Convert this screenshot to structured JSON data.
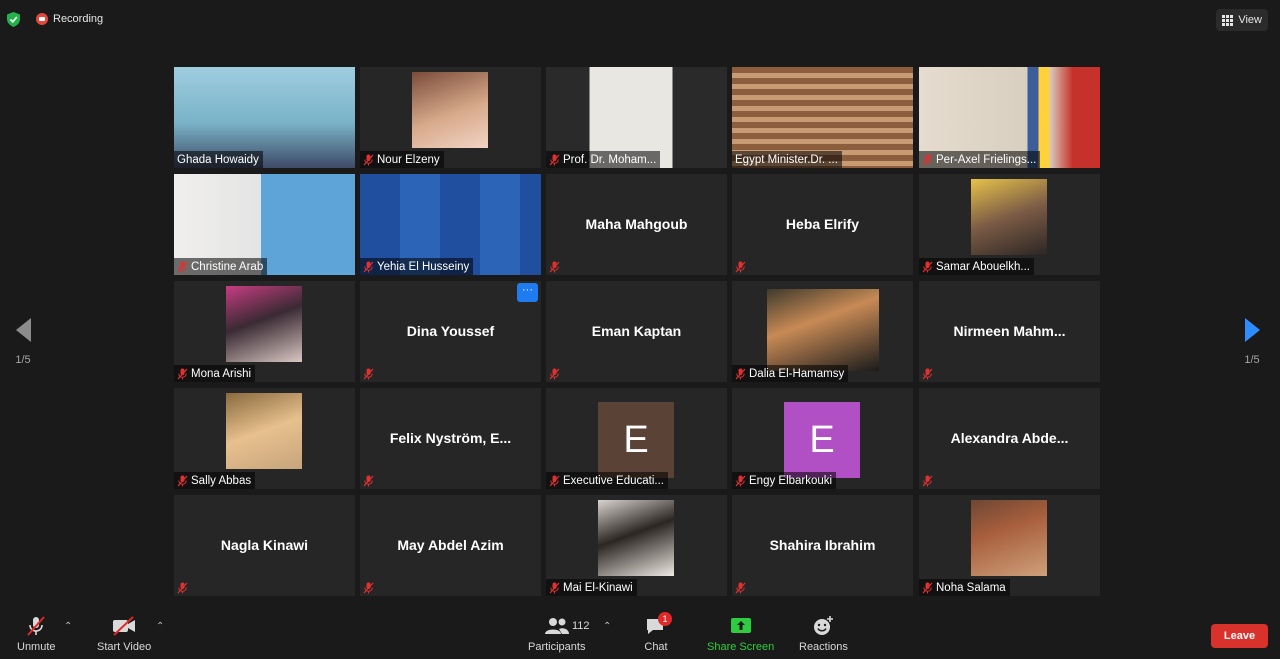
{
  "topbar": {
    "recording_label": "Recording",
    "view_label": "View"
  },
  "pager": {
    "left_page": "1/5",
    "right_page": "1/5"
  },
  "participants": [
    {
      "name": "Ghada Howaidy",
      "type": "video",
      "muted": false
    },
    {
      "name": "Nour Elzeny",
      "type": "photo",
      "muted": true
    },
    {
      "name": "Prof. Dr. Moham...",
      "type": "video",
      "muted": true
    },
    {
      "name": "Egypt Minister.Dr. ...",
      "type": "video",
      "muted": false,
      "active_speaker": true
    },
    {
      "name": "Per-Axel Frielings...",
      "type": "video",
      "muted": true
    },
    {
      "name": "Christine Arab",
      "type": "video",
      "muted": true
    },
    {
      "name": "Yehia El Husseiny",
      "type": "video",
      "muted": true
    },
    {
      "name": "Maha Mahgoub",
      "type": "name",
      "muted": true
    },
    {
      "name": "Heba Elrify",
      "type": "name",
      "muted": true
    },
    {
      "name": "Samar Abouelkh...",
      "type": "photo",
      "muted": true
    },
    {
      "name": "Mona Arishi",
      "type": "photo",
      "muted": true
    },
    {
      "name": "Dina Youssef",
      "type": "name",
      "muted": true,
      "more_menu": "···"
    },
    {
      "name": "Eman Kaptan",
      "type": "name",
      "muted": true
    },
    {
      "name": "Dalia El-Hamamsy",
      "type": "photo",
      "muted": true
    },
    {
      "name": "Nirmeen  Mahm...",
      "type": "name",
      "muted": true
    },
    {
      "name": "Sally Abbas",
      "type": "photo",
      "muted": true
    },
    {
      "name": "Felix Nyström, E...",
      "type": "name",
      "muted": true
    },
    {
      "name": "Executive Educati...",
      "type": "letter",
      "letter": "E",
      "color": "#5b4236",
      "muted": true
    },
    {
      "name": "Engy Elbarkouki",
      "type": "letter",
      "letter": "E",
      "color": "#b14fc5",
      "muted": true
    },
    {
      "name": "Alexandra  Abde...",
      "type": "name",
      "muted": true
    },
    {
      "name": "Nagla Kinawi",
      "type": "name",
      "muted": true
    },
    {
      "name": "May Abdel Azim",
      "type": "name",
      "muted": true
    },
    {
      "name": "Mai El-Kinawi",
      "type": "photo",
      "muted": true
    },
    {
      "name": "Shahira Ibrahim",
      "type": "name",
      "muted": true
    },
    {
      "name": "Noha Salama",
      "type": "photo",
      "muted": true
    }
  ],
  "toolbar": {
    "unmute_label": "Unmute",
    "start_video_label": "Start Video",
    "participants_label": "Participants",
    "participants_count": "112",
    "chat_label": "Chat",
    "chat_badge": "1",
    "share_label": "Share Screen",
    "reactions_label": "Reactions",
    "leave_label": "Leave"
  },
  "colors": {
    "accent_blue": "#2d8cff",
    "leave_red": "#d9312c",
    "share_green": "#2ecc40",
    "speaker_highlight": "#d6e36b"
  }
}
